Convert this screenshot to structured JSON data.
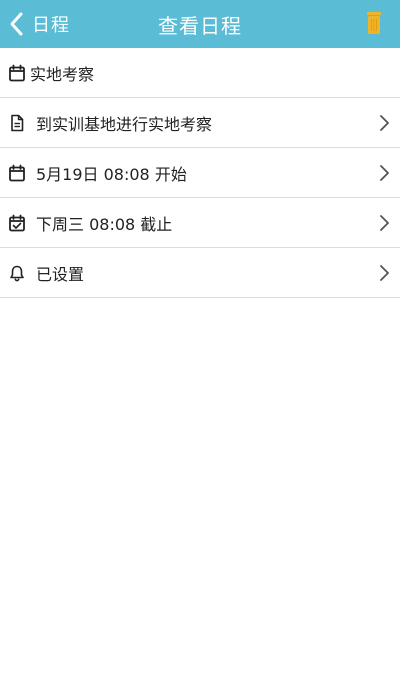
{
  "header": {
    "back_label": "日程",
    "title": "查看日程",
    "trash_icon": "trash-icon",
    "accent": "#5bbcd6",
    "trash_color": "#f0b429"
  },
  "category": {
    "icon": "calendar-icon",
    "label": "实地考察"
  },
  "rows": [
    {
      "icon": "document-icon",
      "label": "到实训基地进行实地考察"
    },
    {
      "icon": "calendar-icon",
      "label": "5月19日 08:08 开始"
    },
    {
      "icon": "calendar-check-icon",
      "label": "下周三 08:08 截止"
    },
    {
      "icon": "bell-icon",
      "label": "已设置"
    }
  ]
}
